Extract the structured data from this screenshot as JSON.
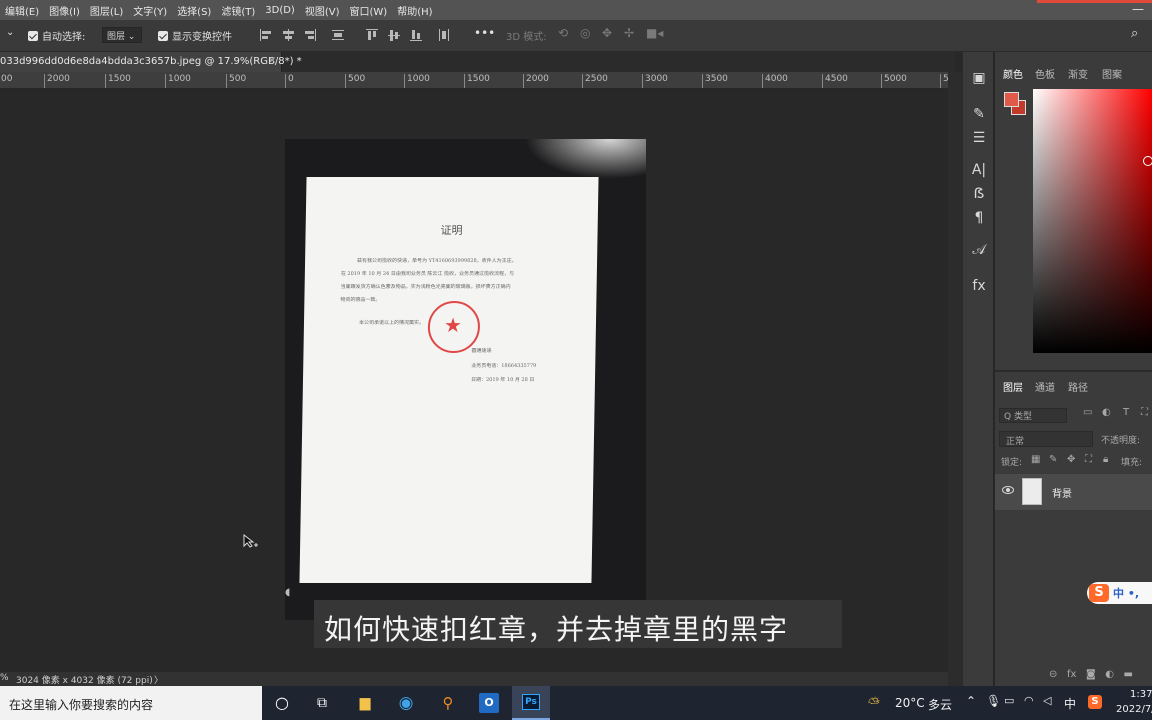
{
  "menu": {
    "items": [
      "编辑(E)",
      "图像(I)",
      "图层(L)",
      "文字(Y)",
      "选择(S)",
      "滤镜(T)",
      "3D(D)",
      "视图(V)",
      "窗口(W)",
      "帮助(H)"
    ],
    "minimize": "—"
  },
  "options": {
    "auto_select_label": "自动选择:",
    "auto_select_value": "图层",
    "show_transform_label": "显示变换控件",
    "more": "•••",
    "mode_3d_label": "3D 模式:"
  },
  "tab": {
    "label": "033d996dd0d6e8da4bdda3c3657b.jpeg @ 17.9%(RGB/8*) *",
    "close": "×"
  },
  "ruler": {
    "ticks": [
      "00",
      "2000",
      "1500",
      "1000",
      "500",
      "0",
      "500",
      "1000",
      "1500",
      "2000",
      "2500",
      "3000",
      "3500",
      "4000",
      "4500",
      "5000",
      "5"
    ]
  },
  "document_image": {
    "heading": "证明",
    "lines": [
      "兹有我公司揽收的快递，单号为 YT4160693999828，收件人为王庄，",
      "在 2019 年 10 月 24 日由我司业务员 陈云江 揽收，业务员通过揽收流程，与",
      "当面跟发货方确认色素及物品，实为浅粉色光亮面的玻璃瓶，损坏责方正确内",
      "物资的赔品一致。",
      "本公司承诺以上的情况属实。",
      "圆通速递",
      "业务员电话：18664335779",
      "日期：2019 年 10 月 28 日"
    ]
  },
  "subtitle": "如何快速扣红章，并去掉章里的黑字",
  "status": {
    "zoom": "%",
    "dimensions": "3024 像素 x 4032 像素 (72 ppi)",
    "arrow": "〉"
  },
  "panels": {
    "color_tabs": [
      "颜色",
      "色板",
      "渐变",
      "图案"
    ],
    "layer_tabs": [
      "图层",
      "通道",
      "路径"
    ],
    "kind_label": "Q 类型",
    "blend_mode": "正常",
    "opacity_label": "不透明度:",
    "lock_label": "锁定:",
    "fill_label": "填充:",
    "layer_name": "背景",
    "ime_label": "中 •,"
  },
  "taskbar": {
    "search_placeholder": "在这里输入你要搜索的内容",
    "temperature": "20°C",
    "weather": "多云",
    "ime": "中",
    "time": "1:37",
    "date": "2022/7/"
  },
  "colors": {
    "foreground": "#e05a4a",
    "background": "#c23a2a",
    "stamp": "#e04848"
  }
}
